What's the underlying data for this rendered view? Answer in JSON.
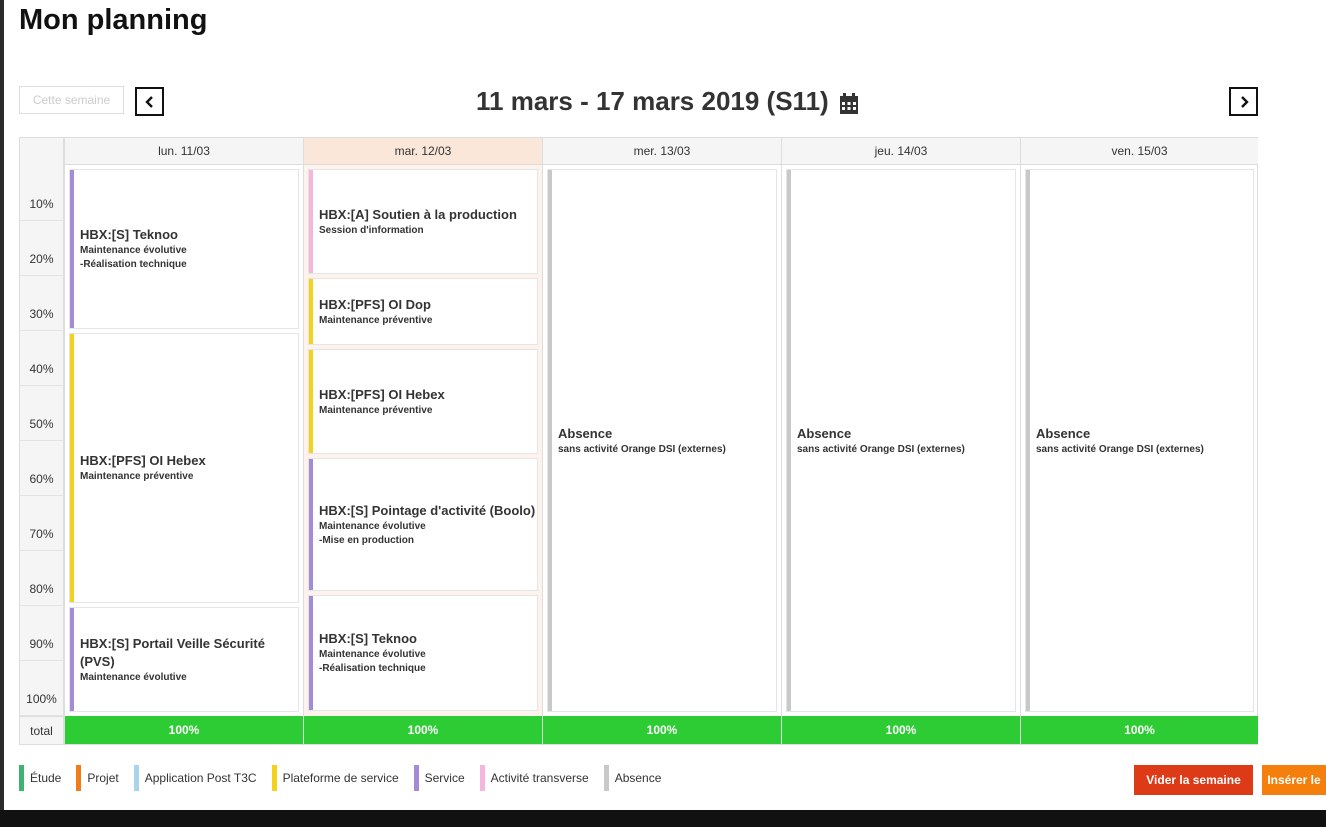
{
  "page": {
    "title": "Mon planning"
  },
  "toolbar": {
    "this_week_label": "Cette semaine",
    "prev_icon": "chevron-left-icon",
    "next_icon": "chevron-right-icon",
    "week_title": "11 mars - 17 mars 2019 (S11)",
    "calendar_icon": "calendar-icon"
  },
  "grid": {
    "ticks": [
      "10%",
      "20%",
      "30%",
      "40%",
      "50%",
      "60%",
      "70%",
      "80%",
      "90%",
      "100%"
    ],
    "total_label": "total",
    "columns": [
      {
        "header": "lun. 11/03",
        "today": false,
        "total": "100%",
        "events": [
          {
            "title": "HBX:[S] Teknoo",
            "subtitle": "Maintenance évolutive\n-Réalisation technique",
            "category": "Service",
            "share": 0.3
          },
          {
            "title": "HBX:[PFS] OI Hebex",
            "subtitle": "Maintenance préventive",
            "category": "Plateforme de service",
            "share": 0.5
          },
          {
            "title": "HBX:[S] Portail Veille Sécurité (PVS)",
            "subtitle": "Maintenance évolutive",
            "category": "Service",
            "share": 0.2
          }
        ]
      },
      {
        "header": "mar. 12/03",
        "today": true,
        "total": "100%",
        "events": [
          {
            "title": "HBX:[A] Soutien à la production",
            "subtitle": "Session d'information",
            "category": "Activité transverse",
            "share": 0.2
          },
          {
            "title": "HBX:[PFS] OI Dop",
            "subtitle": "Maintenance préventive",
            "category": "Plateforme de service",
            "share": 0.13
          },
          {
            "title": "HBX:[PFS] OI Hebex",
            "subtitle": "Maintenance préventive",
            "category": "Plateforme de service",
            "share": 0.2
          },
          {
            "title": "HBX:[S] Pointage d'activité (Boolo)",
            "subtitle": "Maintenance évolutive\n-Mise en production",
            "category": "Service",
            "share": 0.25
          },
          {
            "title": "HBX:[S] Teknoo",
            "subtitle": "Maintenance évolutive\n-Réalisation technique",
            "category": "Service",
            "share": 0.22
          }
        ]
      },
      {
        "header": "mer. 13/03",
        "today": false,
        "total": "100%",
        "events": [
          {
            "title": "Absence",
            "subtitle": "sans activité Orange DSI (externes)",
            "category": "Absence",
            "share": 1.0
          }
        ]
      },
      {
        "header": "jeu. 14/03",
        "today": false,
        "total": "100%",
        "events": [
          {
            "title": "Absence",
            "subtitle": "sans activité Orange DSI (externes)",
            "category": "Absence",
            "share": 1.0
          }
        ]
      },
      {
        "header": "ven. 15/03",
        "today": false,
        "total": "100%",
        "events": [
          {
            "title": "Absence",
            "subtitle": "sans activité Orange DSI (externes)",
            "category": "Absence",
            "share": 1.0
          }
        ]
      }
    ]
  },
  "legend": [
    {
      "label": "Étude",
      "color": "#3cb371"
    },
    {
      "label": "Projet",
      "color": "#f07d1a"
    },
    {
      "label": "Application Post T3C",
      "color": "#a8d4ec"
    },
    {
      "label": "Plateforme de service",
      "color": "#f2d21b"
    },
    {
      "label": "Service",
      "color": "#a58bd6"
    },
    {
      "label": "Activité transverse",
      "color": "#f5b6dc"
    },
    {
      "label": "Absence",
      "color": "#c8c8c8"
    }
  ],
  "actions": {
    "clear_week": "Vider la semaine",
    "insert": "Insérer le",
    "clear_color": "#dd3b18",
    "insert_color": "#f47f0d"
  }
}
